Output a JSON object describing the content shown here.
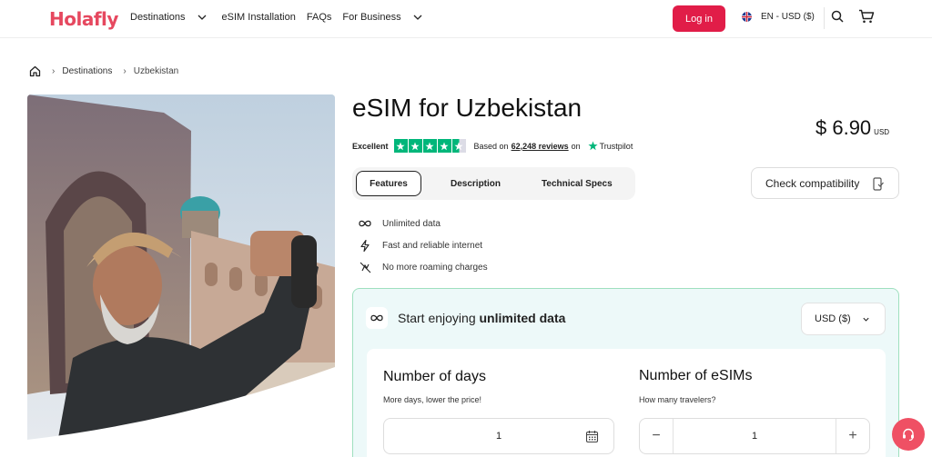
{
  "header": {
    "logo": "Holafly",
    "nav": [
      {
        "label": "Destinations",
        "dropdown": true
      },
      {
        "label": "eSIM Installation",
        "dropdown": false
      },
      {
        "label": "FAQs",
        "dropdown": false
      },
      {
        "label": "For Business",
        "dropdown": true
      }
    ],
    "login_label": "Log in",
    "language_label": "EN - USD ($)"
  },
  "breadcrumb": {
    "items": [
      "Destinations",
      "Uzbekistan"
    ]
  },
  "product": {
    "title": "eSIM for Uzbekistan",
    "price": "$ 6.90",
    "price_currency": "USD",
    "rating": {
      "label": "Excellent",
      "stars": 4.5,
      "based_on": "Based on",
      "reviews": "62,248 reviews",
      "on": "on",
      "provider": "Trustpilot"
    },
    "tabs": [
      {
        "label": "Features",
        "active": true
      },
      {
        "label": "Description",
        "active": false
      },
      {
        "label": "Technical Specs",
        "active": false
      }
    ],
    "check_label": "Check compatibility",
    "features": [
      {
        "icon": "infinity-icon",
        "label": "Unlimited data"
      },
      {
        "icon": "lightning-icon",
        "label": "Fast and reliable internet"
      },
      {
        "icon": "no-roaming-icon",
        "label": "No more roaming charges"
      }
    ]
  },
  "plan": {
    "title_prefix": "Start enjoying",
    "title_bold": "unlimited data",
    "currency_select": "USD ($)",
    "days": {
      "heading": "Number of days",
      "sub": "More days, lower the price!",
      "value": "1"
    },
    "esims": {
      "heading": "Number of eSIMs",
      "sub": "How many travelers?",
      "value": "1"
    }
  },
  "colors": {
    "brand": "#e6485f",
    "login": "#e11d48",
    "trustpilot": "#00b67a",
    "plan_bg": "#edf9f9",
    "plan_border": "#9fe0bf"
  }
}
